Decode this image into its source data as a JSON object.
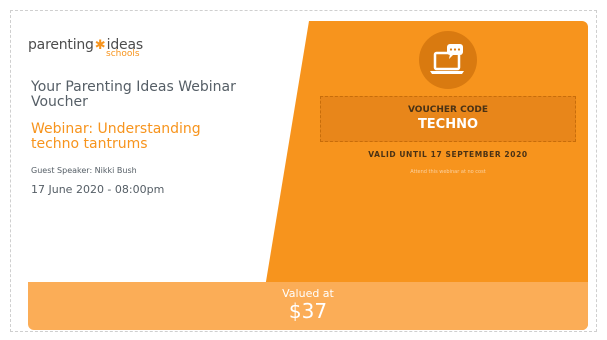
{
  "logo": {
    "main_left": "parenting",
    "main_right": "ideas",
    "sub": "schools"
  },
  "voucher": {
    "title": "Your Parenting Ideas Webinar Voucher",
    "webinar_title": "Webinar: Understanding techno tantrums",
    "speaker": "Guest Speaker: Nikki Bush",
    "date": "17 June 2020 - 08:00pm",
    "code_label": "VOUCHER CODE",
    "code": "TECHNO",
    "valid_until": "VALID UNTIL 17 SEPTEMBER 2020",
    "attend_note": "Attend this webinar at no cost",
    "valued_label": "Valued at",
    "valued_amount": "$37"
  },
  "icon": "laptop-chat-icon",
  "colors": {
    "orange": "#f7941d",
    "orange_light": "#fbad57",
    "orange_dark": "#d97a10",
    "text_gray": "#555e66"
  }
}
